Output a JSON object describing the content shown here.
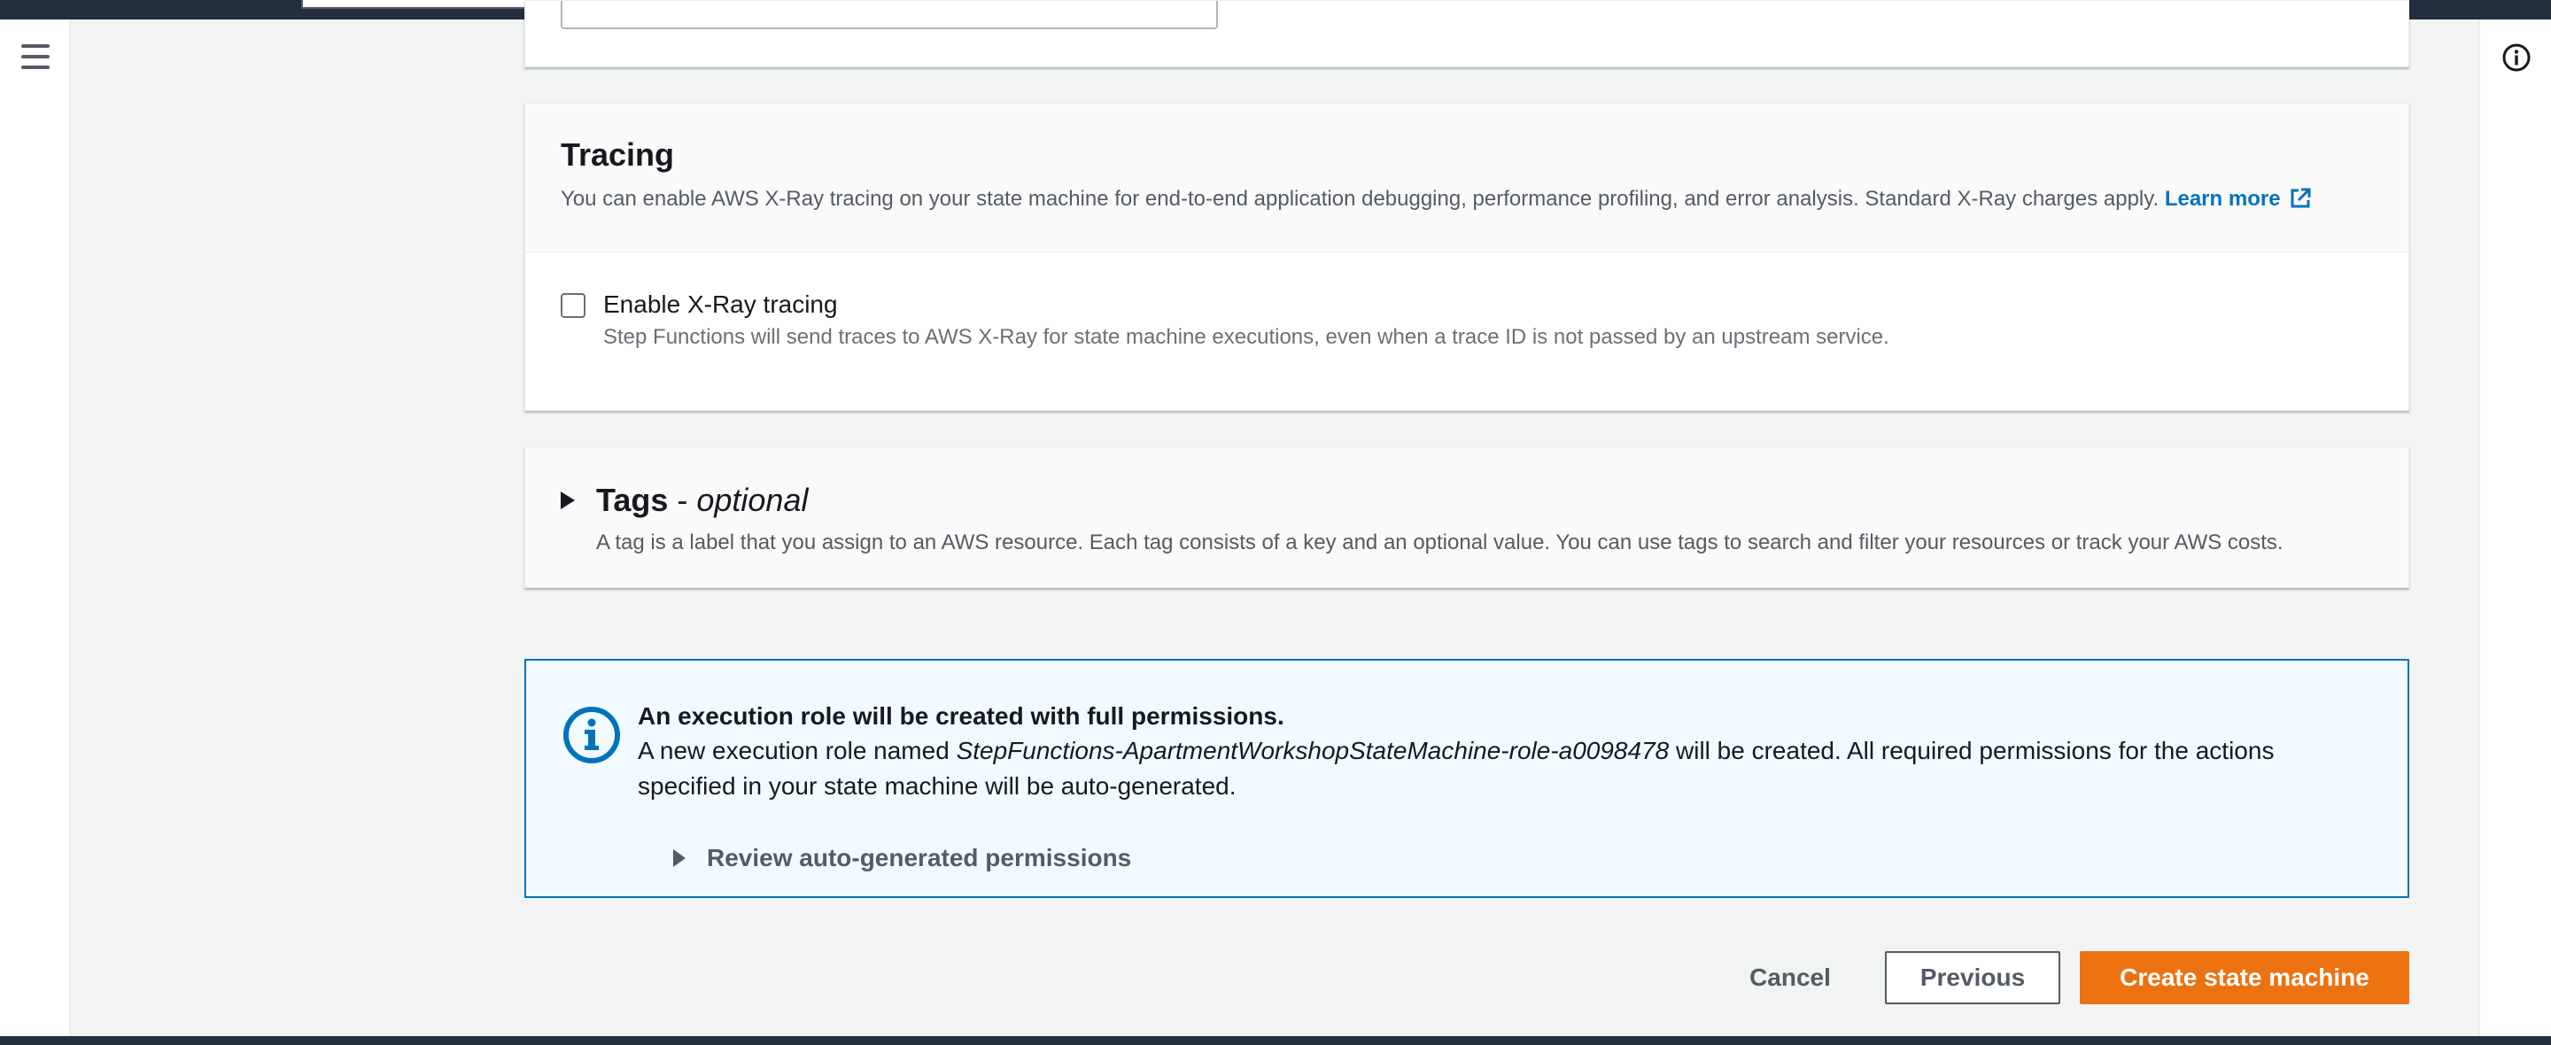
{
  "tracing": {
    "title": "Tracing",
    "description": "You can enable AWS X-Ray tracing on your state machine for end-to-end application debugging, performance profiling, and error analysis. Standard X-Ray charges apply.",
    "learn_more": "Learn more",
    "checkbox_label": "Enable X-Ray tracing",
    "checkbox_checked": false,
    "checkbox_description": "Step Functions will send traces to AWS X-Ray for state machine executions, even when a trace ID is not passed by an upstream service."
  },
  "tags": {
    "title": "Tags",
    "separator": "-",
    "optional": "optional",
    "description": "A tag is a label that you assign to an AWS resource. Each tag consists of a key and an optional value. You can use tags to search and filter your resources or track your AWS costs."
  },
  "alert": {
    "title": "An execution role will be created with full permissions.",
    "text_before": "A new execution role named ",
    "role_name": "StepFunctions-ApartmentWorkshopStateMachine-role-a0098478",
    "text_after": " will be created. All required permissions for the actions specified in your state machine will be auto-generated.",
    "review_label": "Review auto-generated permissions"
  },
  "actions": {
    "cancel": "Cancel",
    "previous": "Previous",
    "create": "Create state machine"
  },
  "icons": {
    "menu": "hamburger-menu-icon",
    "info": "info-icon",
    "external_link": "external-link-icon",
    "alert_info": "info-circle-icon"
  },
  "colors": {
    "primary": "#ec7211",
    "link": "#0073bb",
    "alert_border": "#0073bb",
    "alert_bg": "#f1faff",
    "topbar": "#232f3e"
  }
}
